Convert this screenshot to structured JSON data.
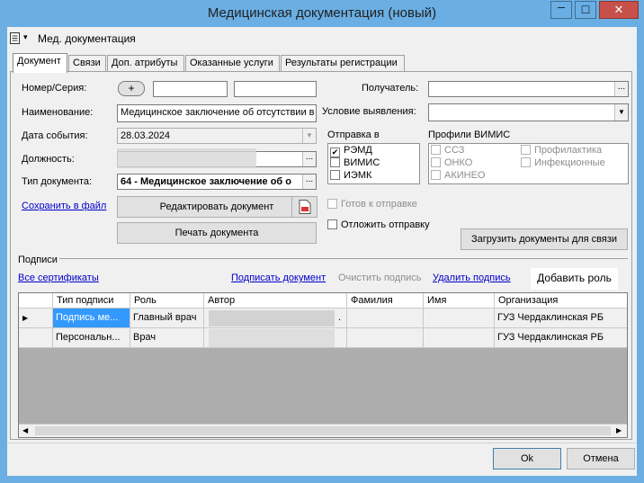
{
  "window": {
    "title": "Медицинская документация (новый)",
    "minimize_glyph": "─",
    "maximize_glyph": "□",
    "close_glyph": "✕"
  },
  "menubar": {
    "menu_label": "Мед. документация",
    "dropdown_glyph": "▾"
  },
  "tabs": [
    {
      "label": "Документ",
      "active": true
    },
    {
      "label": "Связи",
      "active": false
    },
    {
      "label": "Доп. атрибуты",
      "active": false
    },
    {
      "label": "Оказанные услуги",
      "active": false
    },
    {
      "label": "Результаты регистрации",
      "active": false
    }
  ],
  "form": {
    "number_series_label": "Номер/Серия:",
    "plus_button": "+",
    "number_value": "",
    "series_value": "",
    "name_label": "Наименование:",
    "name_value": "Медицинское заключение об отсутствии в",
    "event_date_label": "Дата события:",
    "event_date_value": "28.03.2024",
    "position_label": "Должность:",
    "position_value": "",
    "doc_type_label": "Тип документа:",
    "doc_type_value": "64 - Медицинское заключение об о",
    "ellipsis_button": "...",
    "save_to_file_link": "Сохранить в файл",
    "edit_document_button": "Редактировать документ",
    "print_document_button": "Печать документа",
    "recipient_label": "Получатель:",
    "recipient_value": "",
    "detection_condition_label": "Условие выявления:",
    "detection_condition_value": "",
    "send_to_label": "Отправка в",
    "send_to_items": [
      {
        "label": "РЭМД",
        "checked": true
      },
      {
        "label": "ВИМИС",
        "checked": false
      },
      {
        "label": "ИЭМК",
        "checked": false
      }
    ],
    "vimis_profiles_label": "Профили ВИМИС",
    "vimis_profiles_col1": [
      {
        "label": "ССЗ",
        "checked": false
      },
      {
        "label": "ОНКО",
        "checked": false
      },
      {
        "label": "АКИНЕО",
        "checked": false
      }
    ],
    "vimis_profiles_col2": [
      {
        "label": "Профилактика",
        "checked": false
      },
      {
        "label": "Инфекционные",
        "checked": false
      }
    ],
    "ready_to_send_label": "Готов к отправке",
    "postpone_send_label": "Отложить отправку",
    "load_linked_docs_button": "Загрузить документы для связи"
  },
  "signatures": {
    "group_label": "Подписи",
    "all_certificates_link": "Все сертификаты",
    "sign_document_link": "Подписать документ",
    "clear_signature_label": "Очистить подпись",
    "delete_signature_link": "Удалить подпись",
    "add_role_button": "Добавить роль",
    "columns": [
      "Тип подписи",
      "Роль",
      "Автор",
      "Фамилия",
      "Имя",
      "Организация"
    ],
    "rows": [
      {
        "marker": "▶",
        "sign_type": "Подпись ме...",
        "role": "Главный врач",
        "author": ".",
        "last_name": "",
        "first_name": "",
        "organization": "ГУЗ Чердаклинская РБ"
      },
      {
        "marker": "",
        "sign_type": "Персональн...",
        "role": "Врач",
        "author": "",
        "last_name": "",
        "first_name": "",
        "organization": "ГУЗ Чердаклинская РБ"
      }
    ],
    "scroll_left_glyph": "◀",
    "scroll_right_glyph": "▶"
  },
  "footer": {
    "ok_button": "Ok",
    "cancel_button": "Отмена"
  }
}
